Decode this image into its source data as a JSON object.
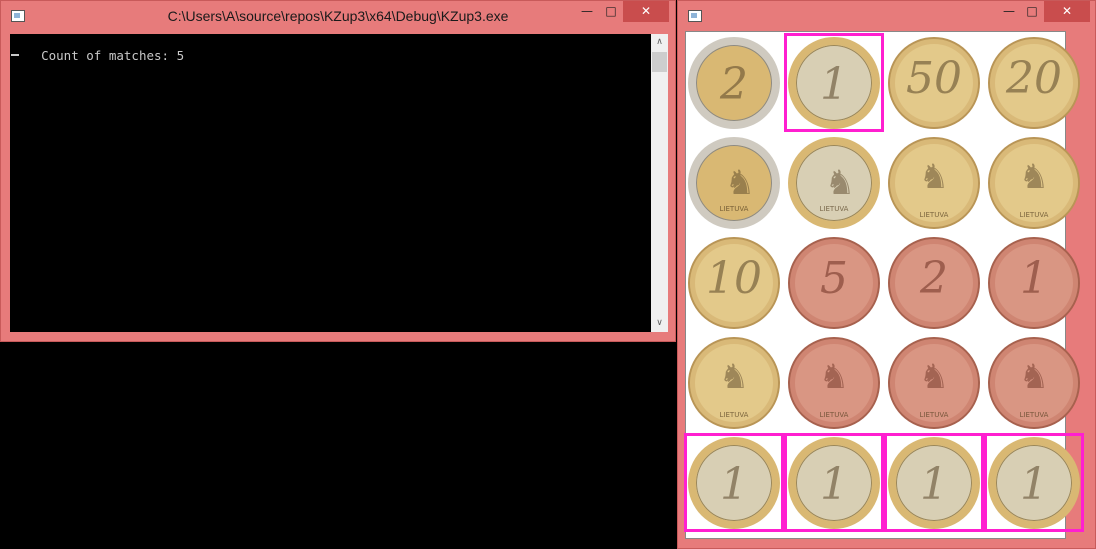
{
  "console_window": {
    "title": "C:\\Users\\A\\source\\repos\\KZup3\\x64\\Debug\\KZup3.exe",
    "minimize": "—",
    "maximize": "□",
    "close": "✕",
    "output": "Count of matches: 5",
    "scroll_up": "∧",
    "scroll_down": "∨"
  },
  "image_window": {
    "title": "",
    "minimize": "—",
    "maximize": "□",
    "close": "✕",
    "coins": [
      [
        "2",
        "1",
        "50",
        "20"
      ],
      [
        "lt-2e",
        "lt-1e",
        "lt-50",
        "lt-20"
      ],
      [
        "10",
        "5",
        "2",
        "1"
      ],
      [
        "lt-10",
        "lt-5",
        "lt-2",
        "lt-1"
      ],
      [
        "1",
        "1",
        "1",
        "1"
      ]
    ],
    "coin_text": "LIETUVA",
    "match_count": 5
  },
  "colors": {
    "window_frame": "#e77b7b",
    "match_box": "#ff1fd0",
    "console_bg": "#000000",
    "console_text": "#c8c8c8"
  }
}
